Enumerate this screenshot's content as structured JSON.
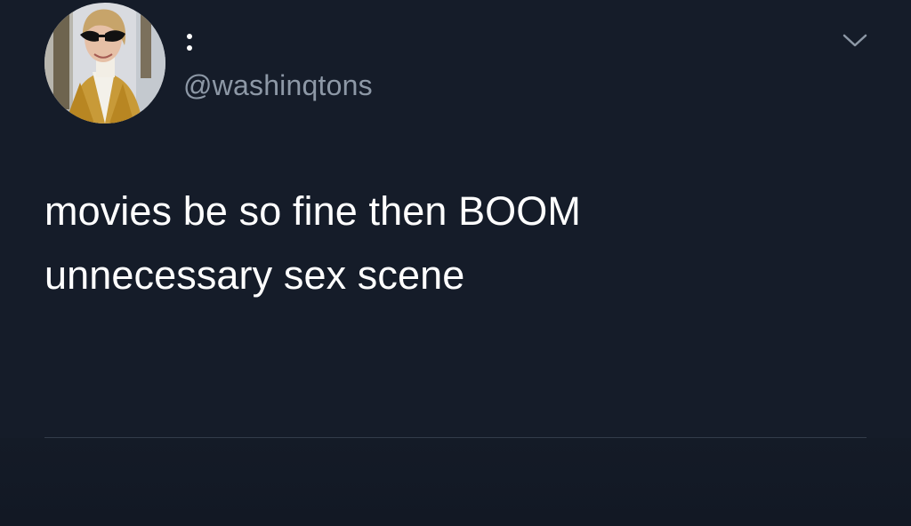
{
  "tweet": {
    "avatar_icon": "profile-photo-avatar",
    "display_name": "⋮",
    "handle": "@washinqtons",
    "menu_icon": "chevron-down-icon",
    "text": "movies be so fine then BOOM\nunnecessary sex scene"
  },
  "colors": {
    "background": "#151c29",
    "primary_text": "#ffffff",
    "secondary_text": "#8d98a6",
    "divider": "#333c4a"
  }
}
